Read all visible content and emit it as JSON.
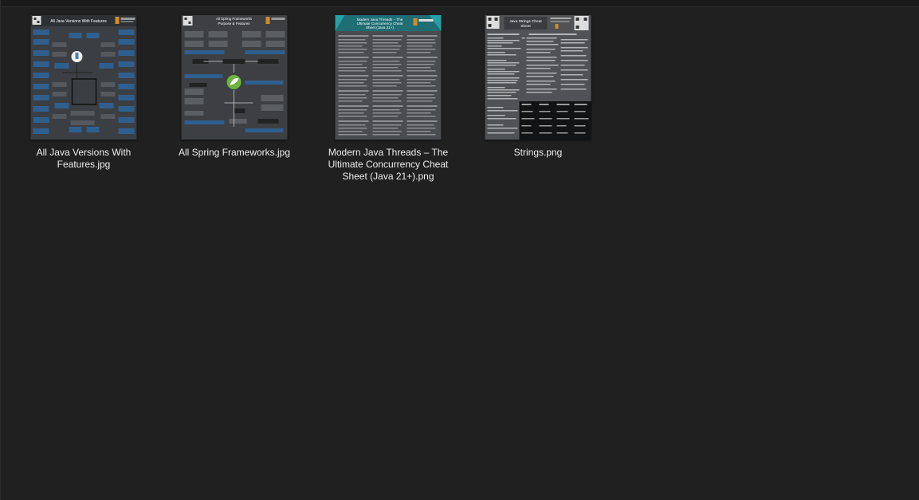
{
  "colors": {
    "background": "#202020",
    "text": "#ededed",
    "accent_blue": "#3a6ea5",
    "accent_teal": "#1fa3a8",
    "spring_green": "#6db33f"
  },
  "files": [
    {
      "name": "All Java Versions With Features.jpg",
      "thumb_title": "All Java Versions With Features",
      "icon": "image-file-thumbnail-icon"
    },
    {
      "name": "All Spring Frameworks.jpg",
      "thumb_title": "All Spring Frameworks Purpose & Features",
      "icon": "image-file-thumbnail-icon"
    },
    {
      "name": "Modern Java Threads – The Ultimate Concurrency Cheat Sheet (Java 21+).png",
      "thumb_title": "Modern Java Threads – The Ultimate Concurrency Cheat Sheet (Java 21+)",
      "icon": "image-file-thumbnail-icon"
    },
    {
      "name": "Strings.png",
      "thumb_title": "Java Strings Cheat Sheet",
      "icon": "image-file-thumbnail-icon"
    }
  ]
}
